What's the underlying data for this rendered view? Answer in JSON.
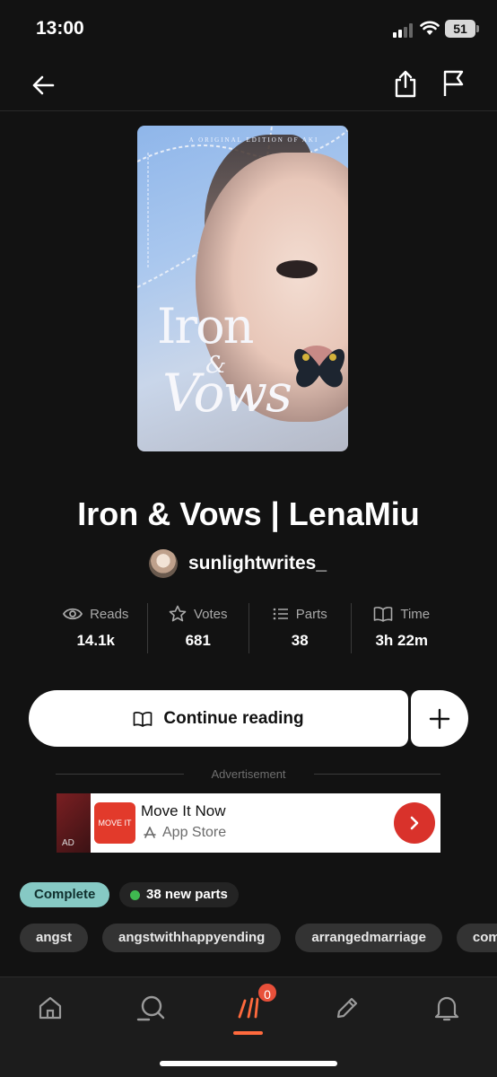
{
  "status_bar": {
    "time": "13:00",
    "battery": "51"
  },
  "cover": {
    "top_line": "A ORIGINAL EDITION OF AKI",
    "title_line1": "Iron",
    "ampersand": "&",
    "title_line2": "Vows"
  },
  "story": {
    "title": "Iron & Vows | LenaMiu",
    "author": "sunlightwrites_"
  },
  "stats": [
    {
      "label": "Reads",
      "value": "14.1k",
      "icon": "eye-icon"
    },
    {
      "label": "Votes",
      "value": "681",
      "icon": "star-icon"
    },
    {
      "label": "Parts",
      "value": "38",
      "icon": "list-icon"
    },
    {
      "label": "Time",
      "value": "3h 22m",
      "icon": "book-icon"
    }
  ],
  "actions": {
    "continue_label": "Continue reading",
    "add_label": "+"
  },
  "ad": {
    "label": "Advertisement",
    "side_text": "AD",
    "logo_text": "MOVE IT",
    "title": "Move It Now",
    "store": "App Store"
  },
  "badges": {
    "status": "Complete",
    "new_parts": "38 new parts"
  },
  "tags": [
    "angst",
    "angstwithhappyending",
    "arrangedmarriage",
    "com"
  ],
  "tabbar": {
    "notification_count": "0",
    "active": "library"
  },
  "colors": {
    "accent": "#ff6a3d",
    "complete": "#86c9c4",
    "new_dot": "#3fb950",
    "background": "#121212"
  }
}
